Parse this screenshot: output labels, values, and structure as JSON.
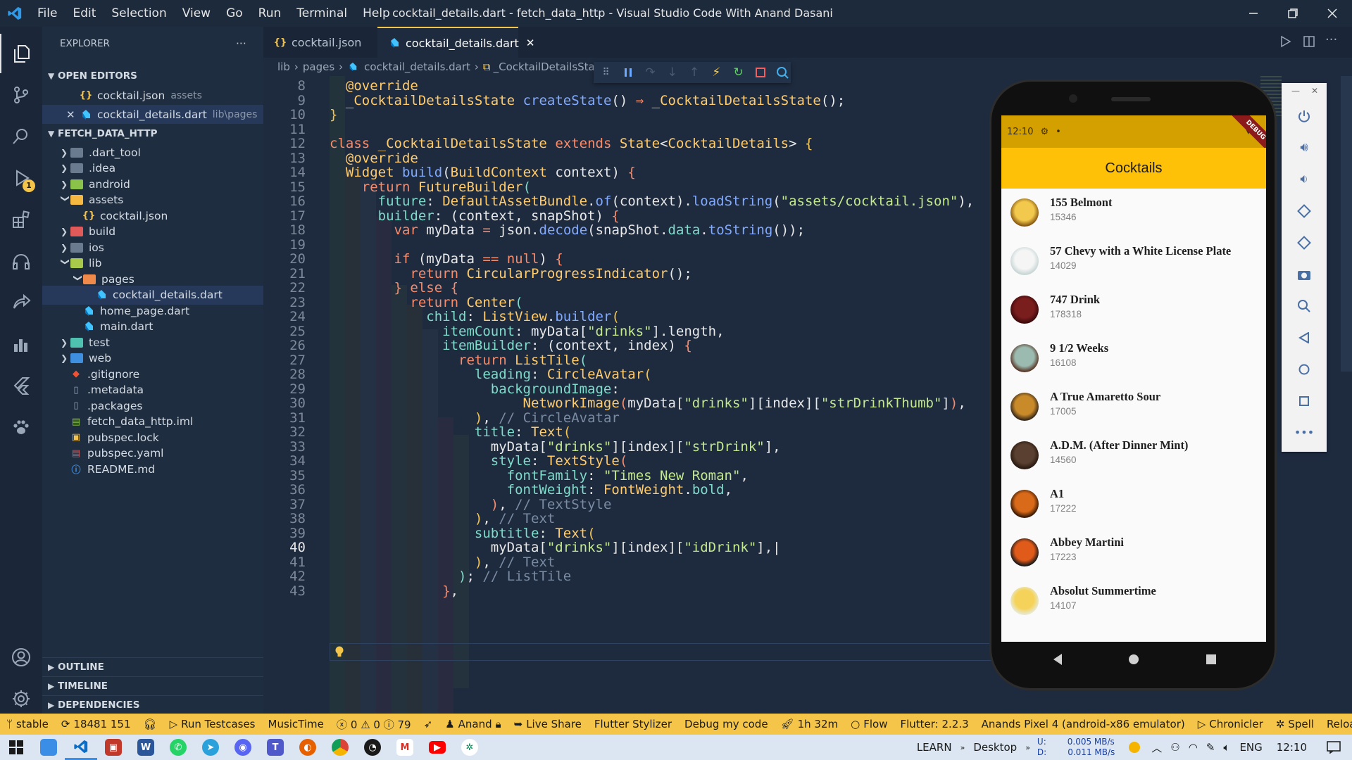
{
  "titlebar": {
    "menus": [
      "File",
      "Edit",
      "Selection",
      "View",
      "Go",
      "Run",
      "Terminal",
      "Help"
    ],
    "title": "cocktail_details.dart - fetch_data_http - Visual Studio Code With Anand Dasani"
  },
  "activity": {
    "debug_badge": "1"
  },
  "sidebar": {
    "title": "EXPLORER",
    "open_editors_label": "OPEN EDITORS",
    "open_editors": [
      {
        "name": "cocktail.json",
        "path": "assets",
        "icon": "json-icon"
      },
      {
        "name": "cocktail_details.dart",
        "path": "lib\\pages",
        "icon": "dart-icon"
      }
    ],
    "project_label": "FETCH_DATA_HTTP",
    "tree": [
      {
        "name": ".dart_tool",
        "kind": "folder"
      },
      {
        "name": ".idea",
        "kind": "folder"
      },
      {
        "name": "android",
        "kind": "folder"
      },
      {
        "name": "assets",
        "kind": "folder-open"
      },
      {
        "name": "cocktail.json",
        "kind": "json"
      },
      {
        "name": "build",
        "kind": "folder"
      },
      {
        "name": "ios",
        "kind": "folder"
      },
      {
        "name": "lib",
        "kind": "folder-open"
      },
      {
        "name": "pages",
        "kind": "folder-open"
      },
      {
        "name": "cocktail_details.dart",
        "kind": "dart"
      },
      {
        "name": "home_page.dart",
        "kind": "dart"
      },
      {
        "name": "main.dart",
        "kind": "dart"
      },
      {
        "name": "test",
        "kind": "folder"
      },
      {
        "name": "web",
        "kind": "folder"
      },
      {
        "name": ".gitignore",
        "kind": "git"
      },
      {
        "name": ".metadata",
        "kind": "file"
      },
      {
        "name": ".packages",
        "kind": "file"
      },
      {
        "name": "fetch_data_http.iml",
        "kind": "iml"
      },
      {
        "name": "pubspec.lock",
        "kind": "lock"
      },
      {
        "name": "pubspec.yaml",
        "kind": "yaml"
      },
      {
        "name": "README.md",
        "kind": "info"
      }
    ],
    "bottom_sections": [
      "OUTLINE",
      "TIMELINE",
      "DEPENDENCIES"
    ]
  },
  "tabs": [
    {
      "label": "cocktail.json",
      "active": false
    },
    {
      "label": "cocktail_details.dart",
      "active": true
    }
  ],
  "breadcrumb": [
    "lib",
    "pages",
    "cocktail_details.dart",
    "_CocktailDetailsSta"
  ],
  "editor": {
    "line_numbers": [
      "8",
      "9",
      "10",
      "11",
      "12",
      "13",
      "14",
      "15",
      "16",
      "17",
      "18",
      "19",
      "20",
      "21",
      "22",
      "23",
      "24",
      "25",
      "26",
      "27",
      "28",
      "29",
      "30",
      "31",
      "32",
      "33",
      "34",
      "35",
      "36",
      "37",
      "38",
      "39",
      "40",
      "41",
      "42",
      "43"
    ],
    "current_line": "40"
  },
  "emulator": {
    "status_time": "12:10",
    "app_title": "Cocktails",
    "banner": "DEBUG",
    "drinks": [
      {
        "name": "155 Belmont",
        "id": "15346"
      },
      {
        "name": "57 Chevy with a White License Plate",
        "id": "14029"
      },
      {
        "name": "747 Drink",
        "id": "178318"
      },
      {
        "name": "9 1/2 Weeks",
        "id": "16108"
      },
      {
        "name": "A True Amaretto Sour",
        "id": "17005"
      },
      {
        "name": "A.D.M. (After Dinner Mint)",
        "id": "14560"
      },
      {
        "name": "A1",
        "id": "17222"
      },
      {
        "name": "Abbey Martini",
        "id": "17223"
      },
      {
        "name": "Absolut Summertime",
        "id": "14107"
      }
    ]
  },
  "statusbar": {
    "branch": "stable",
    "sync": "18481 151",
    "run_testcases": "Run Testcases",
    "music": "MusicTime",
    "problems": "0 ⚠ 0 ⓘ 79",
    "user": "Anand",
    "live_share": "Live Share",
    "stylizer": "Flutter Stylizer",
    "debug_code": "Debug my code",
    "time_spent": "1h 32m",
    "flow": "Flow",
    "flutter": "Flutter: 2.2.3",
    "device": "Anands Pixel 4 (android-x86 emulator)",
    "chronicler": "Chronicler",
    "spell": "Spell",
    "reload": "Reload"
  },
  "taskbar": {
    "learn": "LEARN",
    "desktop": "Desktop",
    "net_up_label": "U:",
    "net_down_label": "D:",
    "net_up": "0.005 MB/s",
    "net_down": "0.011 MB/s",
    "lang": "ENG",
    "time": "12:10"
  }
}
